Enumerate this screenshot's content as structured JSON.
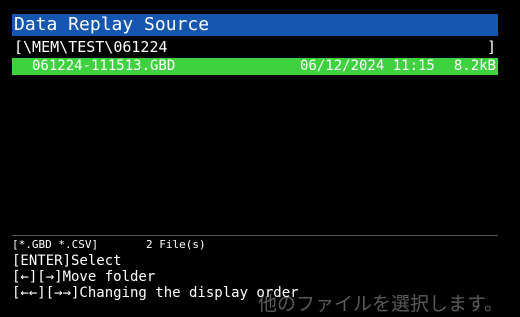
{
  "window": {
    "title": "Data Replay Source"
  },
  "path": {
    "current": "[\\MEM\\TEST\\061224",
    "close_bracket": "]"
  },
  "files": [
    {
      "name": "061224-111513.GBD",
      "date": "06/12/2024 11:15",
      "size": "8.2kB",
      "selected": true
    }
  ],
  "footer": {
    "filter": "[*.GBD *.CSV]",
    "count": "2 File(s)",
    "hints": [
      "[ENTER]Select",
      "[←][→]Move folder",
      "[←←][→→]Changing the display order"
    ]
  },
  "overlay_text": "他のファイルを選択します。",
  "colors": {
    "title_bar": "#1456b0",
    "selected_row": "#3ed33e",
    "background": "#000000"
  }
}
